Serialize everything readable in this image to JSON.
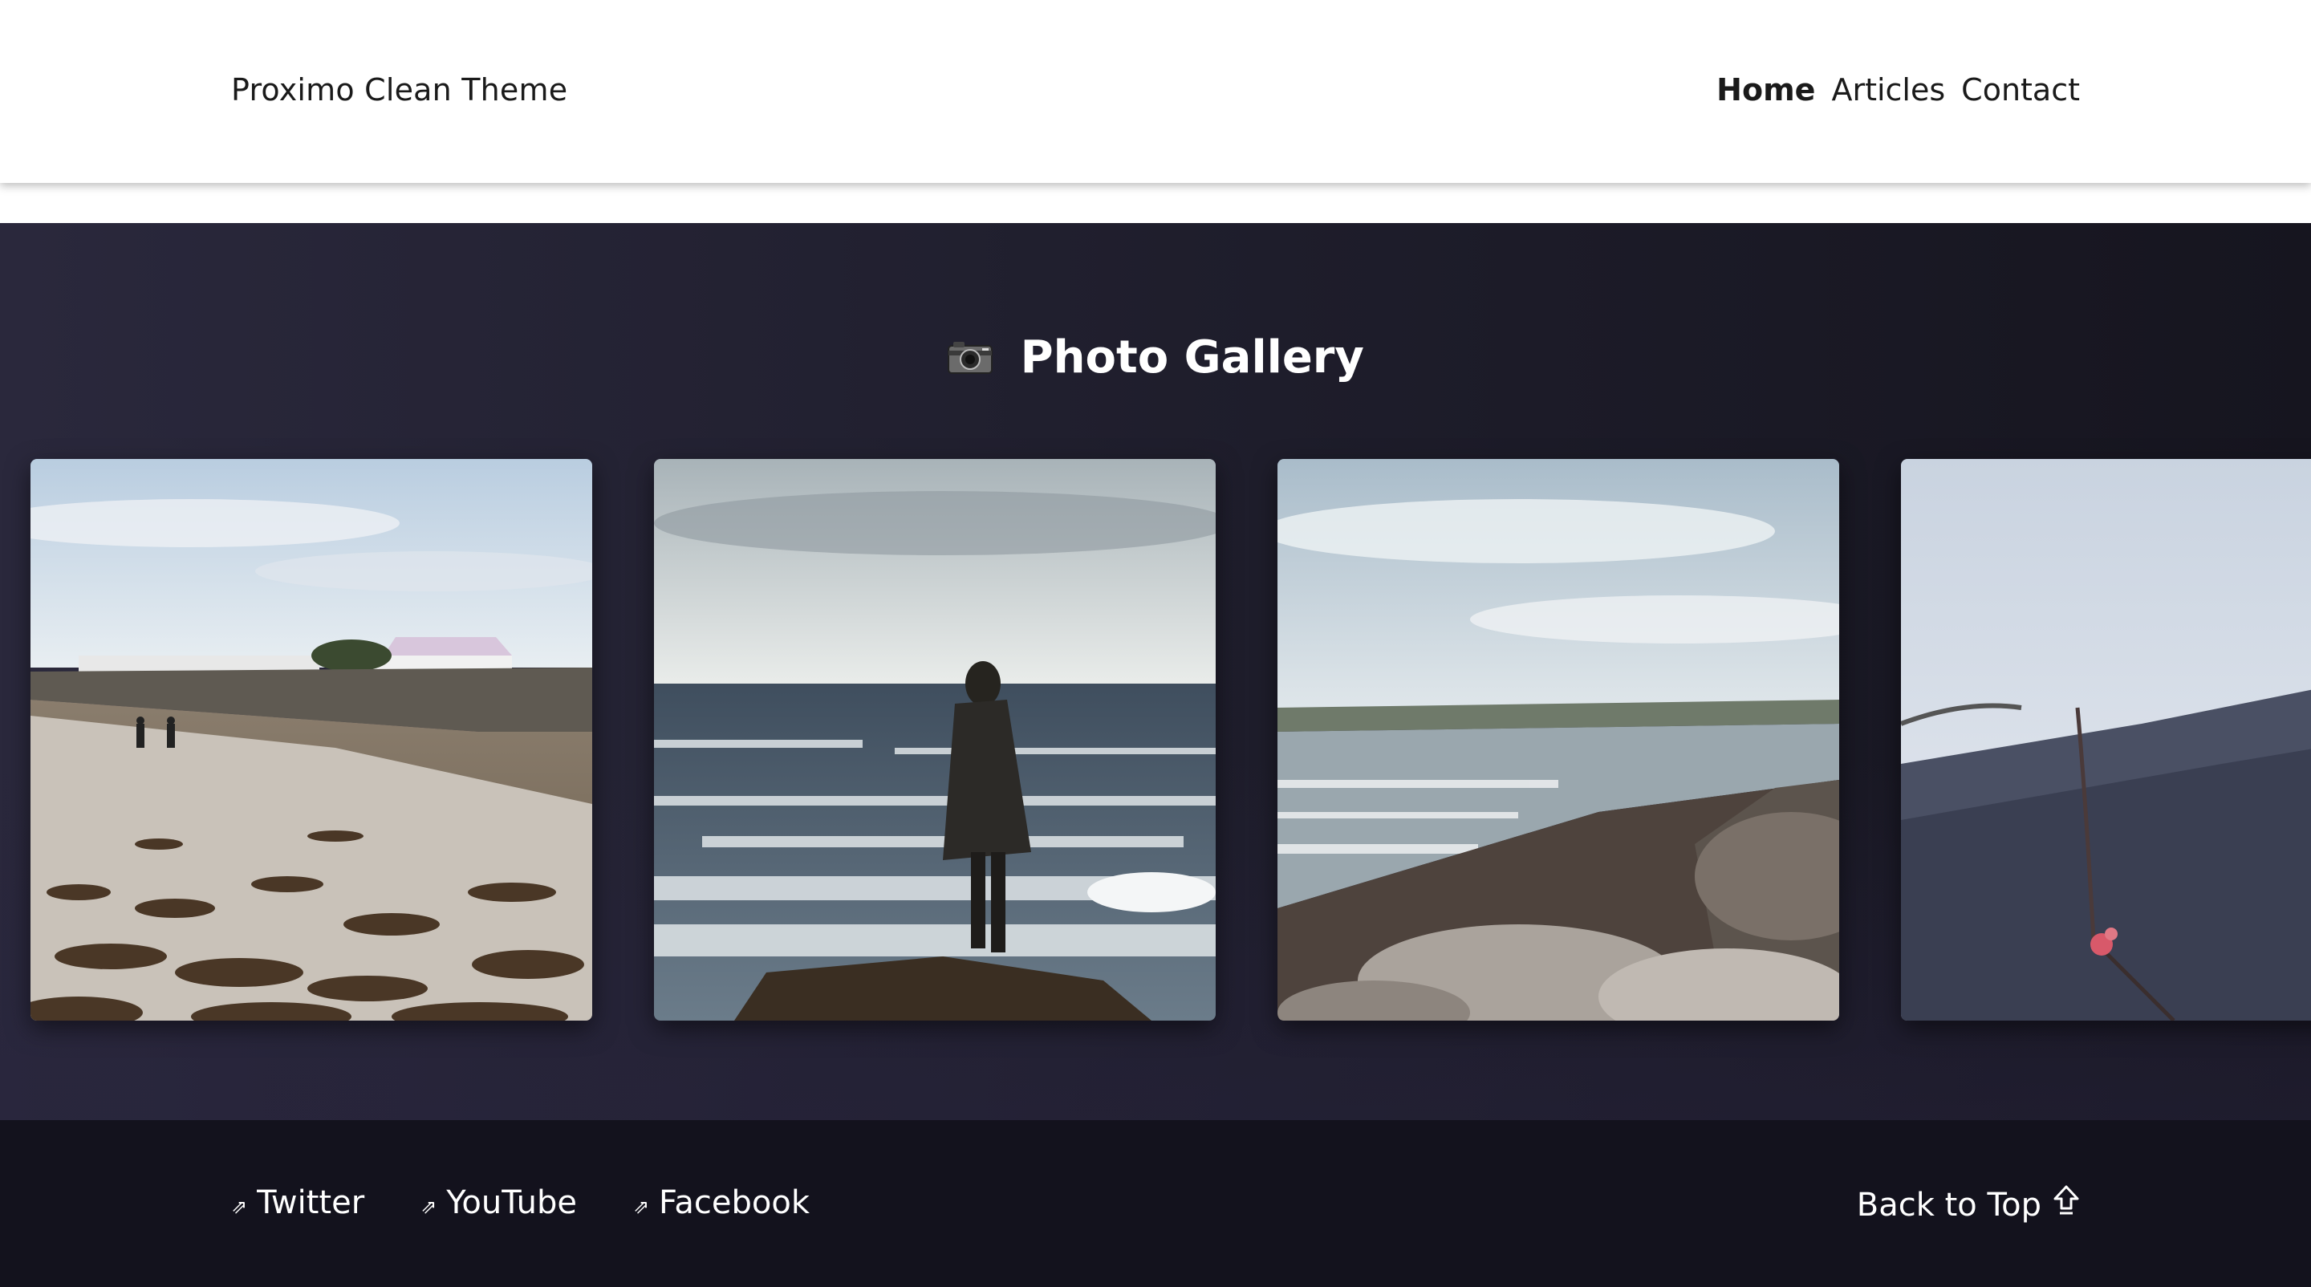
{
  "header": {
    "brand": "Proximo Clean Theme",
    "nav": [
      {
        "label": "Home",
        "active": true
      },
      {
        "label": "Articles",
        "active": false
      },
      {
        "label": "Contact",
        "active": false
      }
    ]
  },
  "gallery": {
    "icon": "camera-icon",
    "title": "Photo Gallery",
    "photos": [
      {
        "name": "beach-walkers-photo"
      },
      {
        "name": "person-on-rock-photo"
      },
      {
        "name": "coastline-photo"
      },
      {
        "name": "blurred-branch-photo"
      }
    ]
  },
  "footer": {
    "social": [
      {
        "label": "Twitter",
        "icon": "external-link-icon"
      },
      {
        "label": "YouTube",
        "icon": "external-link-icon"
      },
      {
        "label": "Facebook",
        "icon": "external-link-icon"
      }
    ],
    "back_to_top": "Back to Top",
    "back_to_top_icon": "up-arrow-icon"
  },
  "colors": {
    "header_bg": "#ffffff",
    "gallery_bg": "#1e1d2b",
    "footer_bg": "#13121d",
    "text_light": "#ffffff",
    "text_dark": "#1a1a1a"
  }
}
